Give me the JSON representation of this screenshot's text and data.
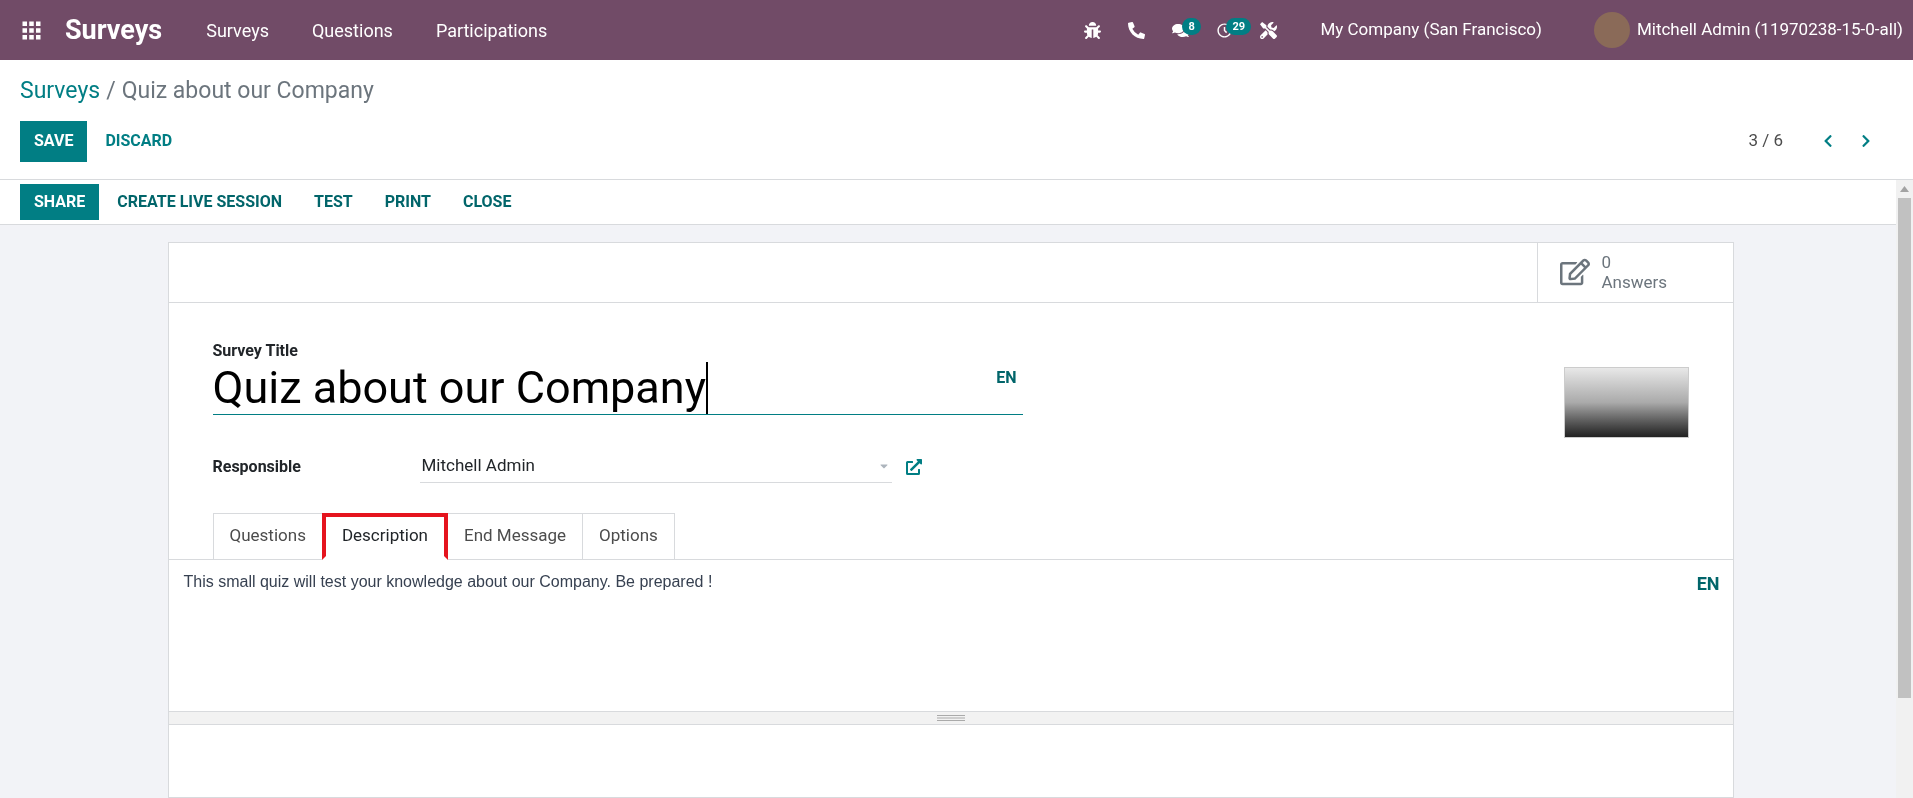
{
  "navbar": {
    "app_name": "Surveys",
    "menu": [
      "Surveys",
      "Questions",
      "Participations"
    ],
    "systray": [
      {
        "kind": "bug"
      },
      {
        "kind": "phone"
      },
      {
        "kind": "chat",
        "badge": "8"
      },
      {
        "kind": "activity",
        "badge": "29"
      },
      {
        "kind": "tools"
      }
    ],
    "company": "My Company (San Francisco)",
    "user": "Mitchell Admin (11970238-15-0-all)"
  },
  "breadcrumb": {
    "parent": "Surveys",
    "separator": "/",
    "current": "Quiz about our Company"
  },
  "form_buttons": [
    "SAVE",
    "DISCARD"
  ],
  "pager": {
    "value": "3 / 6"
  },
  "header_buttons": [
    "SHARE",
    "CREATE LIVE SESSION",
    "TEST",
    "PRINT",
    "CLOSE"
  ],
  "stat_button": {
    "value": "0",
    "label": "Answers"
  },
  "title_field": {
    "label": "Survey Title",
    "value": "Quiz about our Company",
    "lang": "EN"
  },
  "responsible": {
    "label": "Responsible",
    "value": "Mitchell Admin"
  },
  "tabs": [
    {
      "label": "Questions",
      "selected": false,
      "highlighted": false
    },
    {
      "label": "Description",
      "selected": true,
      "highlighted": true
    },
    {
      "label": "End Message",
      "selected": false,
      "highlighted": false
    },
    {
      "label": "Options",
      "selected": false,
      "highlighted": false
    }
  ],
  "description": {
    "text": "This small quiz will test your knowledge about our Company. Be prepared !",
    "lang": "EN"
  }
}
